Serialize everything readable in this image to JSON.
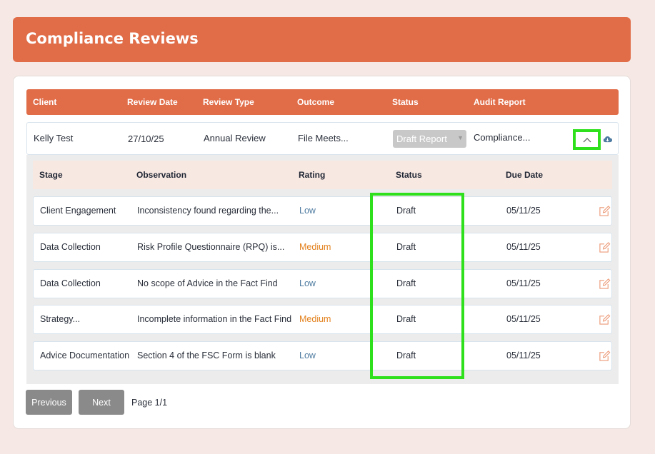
{
  "page": {
    "title": "Compliance Reviews"
  },
  "table": {
    "headers": [
      "Client",
      "Review Date",
      "Review Type",
      "Outcome",
      "Status",
      "Audit Report"
    ],
    "row": {
      "client": "Kelly Test",
      "review_date": "27/10/25",
      "review_type": "Annual Review",
      "outcome": "File Meets...",
      "status": "Draft Report",
      "audit_report": "Compliance..."
    }
  },
  "subtable": {
    "headers": [
      "Stage",
      "Observation",
      "Rating",
      "Status",
      "Due Date"
    ],
    "rows": [
      {
        "stage": "Client Engagement",
        "observation": "Inconsistency found regarding the...",
        "rating": "Low",
        "status": "Draft",
        "due_date": "05/11/25"
      },
      {
        "stage": "Data Collection",
        "observation": "Risk Profile Questionnaire (RPQ) is...",
        "rating": "Medium",
        "status": "Draft",
        "due_date": "05/11/25"
      },
      {
        "stage": "Data Collection",
        "observation": "No scope of Advice in the Fact Find",
        "rating": "Low",
        "status": "Draft",
        "due_date": "05/11/25"
      },
      {
        "stage": "Strategy...",
        "observation": "Incomplete information in the Fact Find",
        "rating": "Medium",
        "status": "Draft",
        "due_date": "05/11/25"
      },
      {
        "stage": "Advice Documentation",
        "observation": "Section 4 of the FSC Form is blank",
        "rating": "Low",
        "status": "Draft",
        "due_date": "05/11/25"
      }
    ]
  },
  "pagination": {
    "previous": "Previous",
    "next": "Next",
    "page_info": "Page 1/1"
  },
  "colors": {
    "accent": "#e06c48",
    "highlight": "#2ee01c",
    "rating_low": "#4d7aa0",
    "rating_medium": "#e3821e"
  },
  "icons": {
    "toggle": "chevron-up-icon",
    "download": "cloud-download-icon",
    "edit": "edit-icon"
  }
}
